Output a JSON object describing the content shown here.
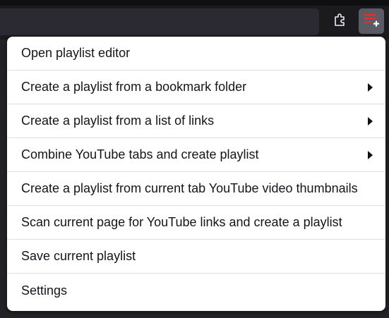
{
  "colors": {
    "menu_background": "#ffffff",
    "menu_text": "#15141a",
    "toolbar_background": "#1b1b1e",
    "playlist_icon_red": "#e0312e"
  },
  "toolbar": {
    "extensions_icon": "puzzle-piece-icon",
    "playlist_icon": "playlist-add-icon"
  },
  "menu": {
    "items": [
      {
        "label": "Open playlist editor",
        "submenu": false
      },
      {
        "label": "Create a playlist from a bookmark folder",
        "submenu": true
      },
      {
        "label": "Create a playlist from a list of links",
        "submenu": true
      },
      {
        "label": "Combine YouTube tabs and create playlist",
        "submenu": true
      },
      {
        "label": "Create a playlist from current tab YouTube video thumbnails",
        "submenu": false
      },
      {
        "label": "Scan current page for YouTube links and create a playlist",
        "submenu": false
      },
      {
        "label": "Save current playlist",
        "submenu": false
      },
      {
        "label": "Settings",
        "submenu": false
      }
    ]
  }
}
